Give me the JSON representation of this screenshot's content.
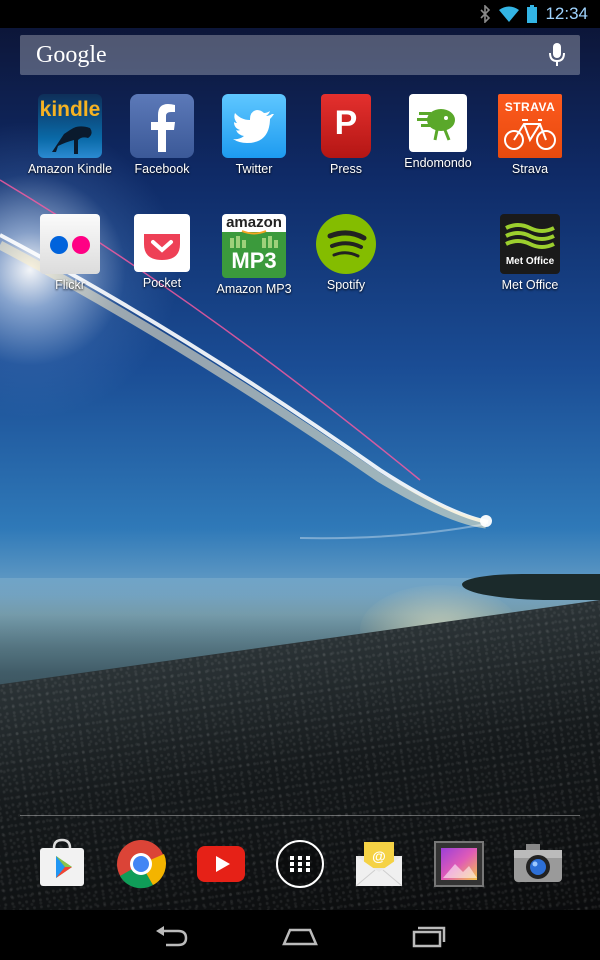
{
  "status_bar": {
    "time": "12:34",
    "icons": [
      "bluetooth-icon",
      "wifi-icon",
      "battery-icon"
    ],
    "time_color": "#9fd4ff"
  },
  "search": {
    "brand": "Google",
    "mic_icon": "microphone-icon"
  },
  "home_apps": [
    {
      "label": "Amazon Kindle",
      "icon": "kindle-icon",
      "icon_text": "kindle"
    },
    {
      "label": "Facebook",
      "icon": "facebook-icon"
    },
    {
      "label": "Twitter",
      "icon": "twitter-icon"
    },
    {
      "label": "Press",
      "icon": "press-icon",
      "icon_text": "P"
    },
    {
      "label": "Endomondo",
      "icon": "endomondo-icon"
    },
    {
      "label": "Strava",
      "icon": "strava-icon",
      "icon_text": "STRAVA"
    },
    {
      "label": "Flickr",
      "icon": "flickr-icon"
    },
    {
      "label": "Pocket",
      "icon": "pocket-icon"
    },
    {
      "label": "Amazon MP3",
      "icon": "amazon-mp3-icon",
      "icon_text": "amazon",
      "icon_text2": "MP3"
    },
    {
      "label": "Spotify",
      "icon": "spotify-icon"
    },
    {
      "label": "Met Office",
      "icon": "met-office-icon",
      "icon_text": "Met Office"
    }
  ],
  "dock": [
    {
      "name": "play-store-icon"
    },
    {
      "name": "chrome-icon"
    },
    {
      "name": "youtube-icon"
    },
    {
      "name": "app-drawer-icon"
    },
    {
      "name": "email-icon"
    },
    {
      "name": "gallery-icon"
    },
    {
      "name": "camera-icon"
    }
  ],
  "nav": [
    "back-icon",
    "home-icon",
    "recents-icon"
  ],
  "colors": {
    "kindle_orange": "#f5b323",
    "facebook_blue": "#3b5998",
    "twitter_blue": "#1d9bf0",
    "press_red": "#d42826",
    "endomondo_green": "#5aa82a",
    "strava_orange": "#fc4c02",
    "flickr_blue": "#0063dc",
    "flickr_pink": "#ff0084",
    "pocket_red": "#ee4056",
    "spotify_green": "#84bd00",
    "youtube_red": "#e62117"
  }
}
